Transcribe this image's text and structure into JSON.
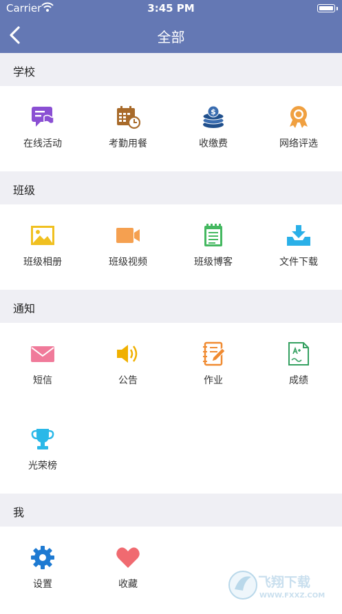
{
  "status_bar": {
    "carrier": "Carrier",
    "time": "3:45 PM"
  },
  "nav": {
    "title": "全部"
  },
  "sections": [
    {
      "title": "学校",
      "items": [
        {
          "label": "在线活动",
          "icon": "activity-icon",
          "color": "#8a4fd3"
        },
        {
          "label": "考勤用餐",
          "icon": "attendance-calendar-icon",
          "color": "#a86a2a"
        },
        {
          "label": "收缴费",
          "icon": "coin-stack-icon",
          "color": "#1f4f8c"
        },
        {
          "label": "网络评选",
          "icon": "award-badge-icon",
          "color": "#f0a040"
        }
      ]
    },
    {
      "title": "班级",
      "items": [
        {
          "label": "班级相册",
          "icon": "photo-album-icon",
          "color": "#f0c020"
        },
        {
          "label": "班级视频",
          "icon": "video-camera-icon",
          "color": "#f5a050"
        },
        {
          "label": "班级博客",
          "icon": "notepad-icon",
          "color": "#44b860"
        },
        {
          "label": "文件下载",
          "icon": "download-tray-icon",
          "color": "#2ab0e8"
        }
      ]
    },
    {
      "title": "通知",
      "items": [
        {
          "label": "短信",
          "icon": "envelope-icon",
          "color": "#f07a9a"
        },
        {
          "label": "公告",
          "icon": "speaker-icon",
          "color": "#f0b000"
        },
        {
          "label": "作业",
          "icon": "notebook-pen-icon",
          "color": "#f08a30"
        },
        {
          "label": "成绩",
          "icon": "report-card-icon",
          "color": "#34a060"
        },
        {
          "label": "光荣榜",
          "icon": "trophy-icon",
          "color": "#2ab8e8"
        }
      ]
    },
    {
      "title": "我",
      "items": [
        {
          "label": "设置",
          "icon": "gear-icon",
          "color": "#1e7ad2"
        },
        {
          "label": "收藏",
          "icon": "heart-icon",
          "color": "#f06a70"
        }
      ]
    }
  ],
  "watermark": {
    "text": "飞翔下载",
    "url": "WWW.FXXZ.COM"
  }
}
